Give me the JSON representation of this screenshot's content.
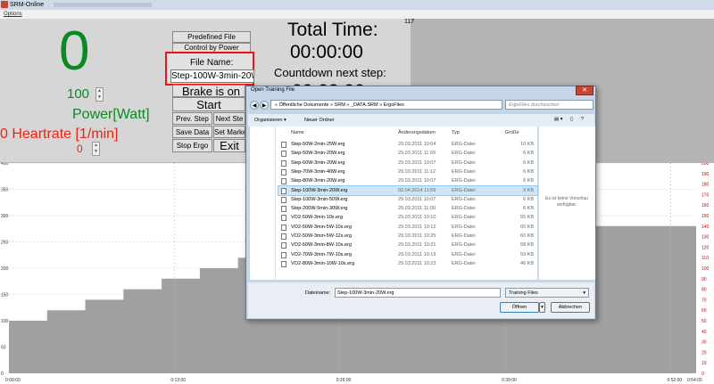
{
  "window": {
    "title": "SRM-Online"
  },
  "menu": {
    "options": "Options"
  },
  "display": {
    "power_value": "0",
    "power_setpoint": "100",
    "power_label": "Power[Watt]",
    "heartrate_label": "0 Heartrate [1/min]",
    "heartrate_value": "0"
  },
  "buttons": {
    "predefined": "Predefined File",
    "control": "Control by Power",
    "file_name_label": "File Name:",
    "file_name_value": "Step-100W-3min-20W",
    "brake": "Brake is on",
    "start": "Start",
    "prev_step": "Prev. Step",
    "next_step": "Next Ste",
    "save_data": "Save Data",
    "set_marker": "Set Marke",
    "stop_ergo": "Stop Ergo",
    "exit": "Exit"
  },
  "timer": {
    "total_label": "Total Time:",
    "total_value": "00:00:00",
    "countdown_label": "Countdown next step:",
    "countdown_value": "00:03:00",
    "counter": "117"
  },
  "chart_data": {
    "type": "area",
    "x_ticks": [
      "0:00:00",
      "0:13:00",
      "0:26:00",
      "0:39:00",
      "0:52:00",
      "0:54:00"
    ],
    "y_left_ticks": [
      "0",
      "50",
      "100",
      "150",
      "200",
      "250",
      "300",
      "350",
      "400"
    ],
    "y_right_ticks": [
      "0",
      "10",
      "20",
      "30",
      "40",
      "50",
      "60",
      "70",
      "80",
      "90",
      "100",
      "110",
      "120",
      "130",
      "140",
      "150",
      "160",
      "170",
      "180",
      "190",
      "200"
    ],
    "ylim_left": [
      0,
      400
    ],
    "ylim_right": [
      0,
      200
    ],
    "xlim_minutes": [
      0,
      54
    ],
    "series": [
      {
        "x_minutes": [
          0,
          3,
          3,
          6,
          6,
          9,
          9,
          12,
          12,
          15,
          15,
          18,
          18,
          21,
          21,
          24,
          24,
          27,
          27,
          54
        ],
        "values": [
          100,
          100,
          120,
          120,
          140,
          140,
          160,
          160,
          180,
          180,
          200,
          200,
          220,
          220,
          240,
          240,
          260,
          260,
          280,
          280
        ]
      }
    ]
  },
  "dialog": {
    "title": "Open Training File",
    "address": "« Öffentliche Dokumente » SRM » _DATA.SRM » ErgoFiles",
    "search_placeholder": "ErgoFiles durchsuchen",
    "organize": "Organisieren ▾",
    "new_folder": "Neuer Ordner",
    "columns": {
      "name": "Name",
      "date": "Änderungsdatum",
      "type": "Typ",
      "size": "Größe"
    },
    "files": [
      {
        "name": "Step-50W-2min-25W.erg",
        "date": "29.03.2011 10:04",
        "type": "ERG-Datei",
        "size": "10 KB"
      },
      {
        "name": "Step-50W-3min-20W.erg",
        "date": "29.03.2011 11:09",
        "type": "ERG-Datei",
        "size": "6 KB"
      },
      {
        "name": "Step-60W-3min-20W.erg",
        "date": "29.03.2011 10:07",
        "type": "ERG-Datei",
        "size": "6 KB"
      },
      {
        "name": "Step-70W-3min-40W.erg",
        "date": "29.03.2011 11:12",
        "type": "ERG-Datei",
        "size": "6 KB"
      },
      {
        "name": "Step-80W-3min-20W.erg",
        "date": "29.03.2011 10:07",
        "type": "ERG-Datei",
        "size": "6 KB"
      },
      {
        "name": "Step-100W-3min-20W.erg",
        "date": "02.04.2014 11:09",
        "type": "ERG-Datei",
        "size": "9 KB"
      },
      {
        "name": "Step-100W-3min-50W.erg",
        "date": "29.03.2011 10:07",
        "type": "ERG-Datei",
        "size": "6 KB"
      },
      {
        "name": "Step-200W-5min-30W.erg",
        "date": "29.03.2011 11:00",
        "type": "ERG-Datei",
        "size": "6 KB"
      },
      {
        "name": "VO2-50W-3min-10s.erg",
        "date": "29.03.2011 10:10",
        "type": "ERG-Datei",
        "size": "55 KB"
      },
      {
        "name": "VO2-50W-3min-5W-10s.erg",
        "date": "29.03.2011 10:12",
        "type": "ERG-Datei",
        "size": "60 KB"
      },
      {
        "name": "VO2-50W-3min-5W-12s.erg",
        "date": "29.03.2011 10:25",
        "type": "ERG-Datei",
        "size": "60 KB"
      },
      {
        "name": "VO2-60W-3min-8W-10s.erg",
        "date": "29.03.2011 10:21",
        "type": "ERG-Datei",
        "size": "58 KB"
      },
      {
        "name": "VO2-70W-3min-7W-10s.erg",
        "date": "29.03.2011 10:19",
        "type": "ERG-Datei",
        "size": "59 KB"
      },
      {
        "name": "VO2-80W-3min-10W-10s.erg",
        "date": "29.03.2011 10:23",
        "type": "ERG-Datei",
        "size": "46 KB"
      }
    ],
    "selected_index": 5,
    "preview_text": "Es ist keine Vorschau verfügbar.",
    "filename_label": "Dateiname:",
    "filename_value": "Step-100W-3min-20W.erg",
    "filetype": "Training Files",
    "open": "Öffnen",
    "cancel": "Abbrechen"
  }
}
